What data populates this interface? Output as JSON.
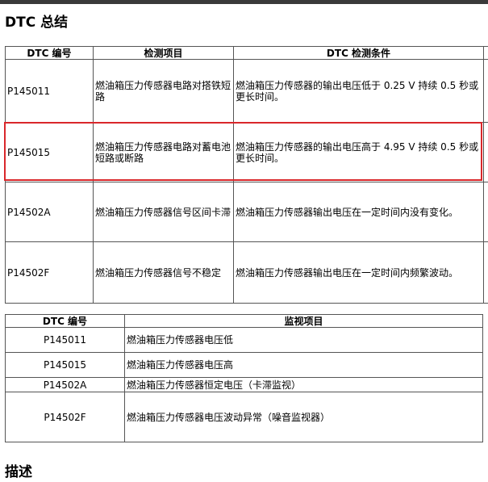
{
  "section_title": "DTC 总结",
  "table1": {
    "headers": [
      "DTC 编号",
      "检测项目",
      "DTC 检测条件"
    ],
    "rows": [
      {
        "code": "P145011",
        "item": "燃油箱压力传感器电路对搭铁短路",
        "condition": "燃油箱压力传感器的输出电压低于 0.25 V 持续 0.5 秒或更长时间。"
      },
      {
        "code": "P145015",
        "item": "燃油箱压力传感器电路对蓄电池短路或断路",
        "condition": "燃油箱压力传感器的输出电压高于 4.95 V 持续 0.5 秒或更长时间。"
      },
      {
        "code": "P14502A",
        "item": "燃油箱压力传感器信号区间卡滞",
        "condition": "燃油箱压力传感器输出电压在一定时间内没有变化。"
      },
      {
        "code": "P14502F",
        "item": "燃油箱压力传感器信号不稳定",
        "condition": "燃油箱压力传感器输出电压在一定时间内频繁波动。"
      }
    ]
  },
  "table2": {
    "headers": [
      "DTC 编号",
      "监视项目"
    ],
    "rows": [
      {
        "code": "P145011",
        "item": "燃油箱压力传感器电压低"
      },
      {
        "code": "P145015",
        "item": "燃油箱压力传感器电压高"
      },
      {
        "code": "P14502A",
        "item": "燃油箱压力传感器恒定电压（卡滞监视）"
      },
      {
        "code": "P14502F",
        "item": "燃油箱压力传感器电压波动异常（噪音监视器）"
      }
    ]
  },
  "next_section_title": "描述",
  "colors": {
    "highlight_border": "#d9272b"
  }
}
